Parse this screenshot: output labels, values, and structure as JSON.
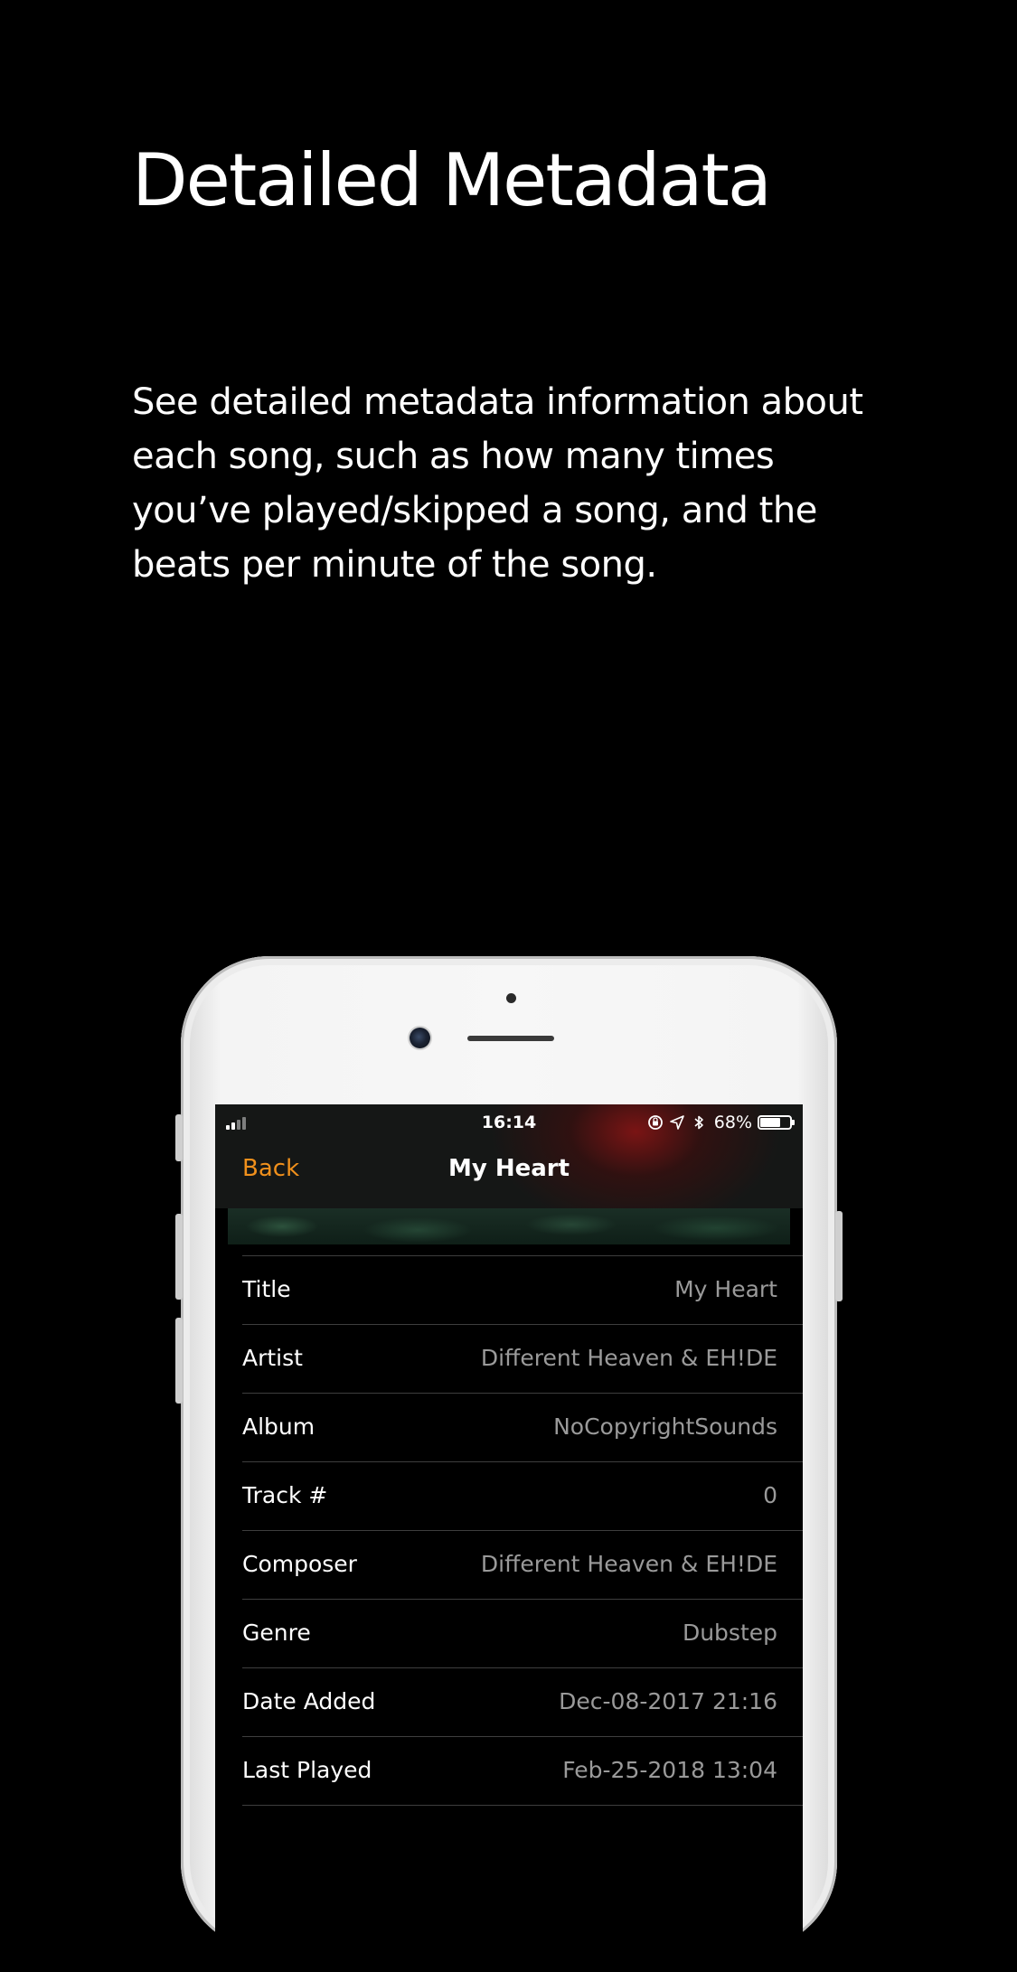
{
  "headline": "Detailed Metadata",
  "description": "See detailed metadata information about each song, such as how many times you’ve played/skipped a song, and the beats per minute of the song.",
  "status_bar": {
    "time": "16:14",
    "battery_percent": "68%",
    "battery_level": 0.68,
    "icons": [
      "signal-icon",
      "orientation-lock-icon",
      "location-icon",
      "bluetooth-icon",
      "battery-icon"
    ]
  },
  "nav": {
    "back_label": "Back",
    "title": "My Heart"
  },
  "colors": {
    "accent": "#f0901c",
    "background": "#000000",
    "value_text": "#9a9a9a"
  },
  "metadata": [
    {
      "label": "Title",
      "value": "My Heart"
    },
    {
      "label": "Artist",
      "value": "Different Heaven & EH!DE"
    },
    {
      "label": "Album",
      "value": "NoCopyrightSounds"
    },
    {
      "label": "Track #",
      "value": "0"
    },
    {
      "label": "Composer",
      "value": "Different Heaven & EH!DE"
    },
    {
      "label": "Genre",
      "value": "Dubstep"
    },
    {
      "label": "Date Added",
      "value": "Dec-08-2017 21:16"
    },
    {
      "label": "Last Played",
      "value": "Feb-25-2018 13:04"
    }
  ]
}
